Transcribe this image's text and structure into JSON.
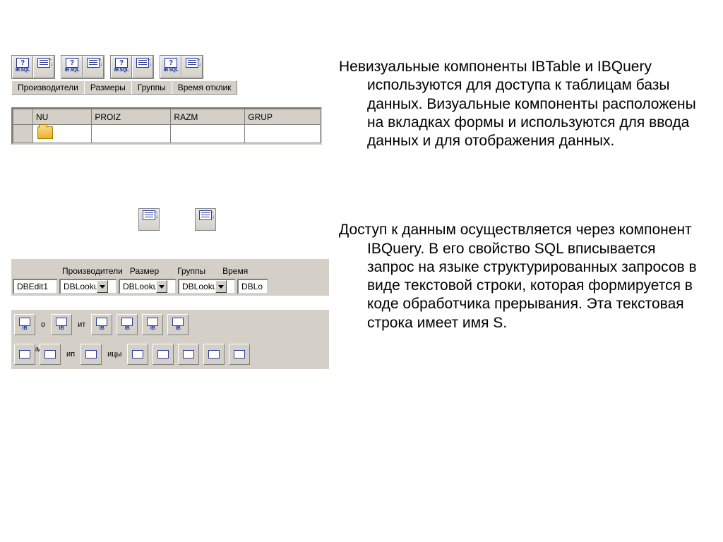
{
  "toolbar_top": {
    "sub_labels": [
      "IB SQL",
      "",
      "IB SQL",
      "",
      "IB SQL",
      "",
      "IB SQL",
      ""
    ]
  },
  "tabs": [
    "Производители",
    "Размеры",
    "Группы",
    "Время отклик"
  ],
  "grid": {
    "headers": [
      "",
      "NU",
      "PROIZ",
      "RAZM",
      "GRUP"
    ],
    "row_count": 1
  },
  "labels_row": [
    "Производители",
    "Размер",
    "Группы",
    "Время"
  ],
  "combo_row": [
    "DBEdit1",
    "DBLooku",
    "DBLooku",
    "DBLooku",
    "DBLo"
  ],
  "bottom_strip1": {
    "icons": 6,
    "sub": "IB",
    "extra_labels": [
      "о",
      "ит"
    ]
  },
  "bottom_strip2": {
    "icons": 8,
    "extra_labels": [
      "азмер",
      "ип",
      "ицы"
    ]
  },
  "text": {
    "p1": "Невизуальные компоненты IBTable и IBQuery используются для доступа к таблицам базы данных. Визуальные компоненты расположены на вкладках формы и используются для ввода данных и для отображения данных.",
    "p2": "Доступ к данным осуществляется через компонент IBQuery. В его свойство SQL вписывается запрос на языке структурированных запросов в виде текстовой строки, которая формируется в коде обработчика прерывания. Эта текстовая строка имеет имя S."
  }
}
